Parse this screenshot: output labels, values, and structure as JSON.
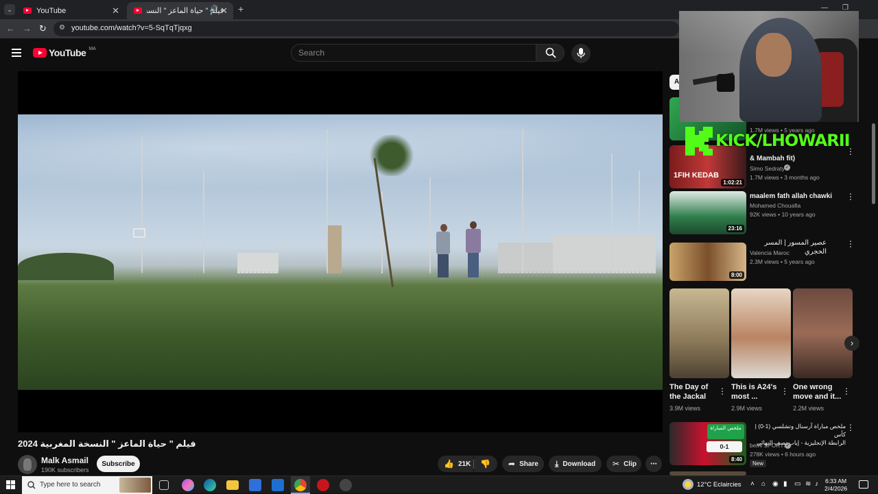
{
  "browser": {
    "tabs": [
      {
        "label": "YouTube"
      },
      {
        "label": "فيلم \" حياة الماعز \" النسخة الم..."
      }
    ],
    "url": "youtube.com/watch?v=5-SqTqTjqxg"
  },
  "youtube": {
    "logo_text": "YouTube",
    "region": "MA",
    "search_placeholder": "Search"
  },
  "video": {
    "title": "فيلم \" حياة الماعز \" النسخة المغربية 2024",
    "channel": "Malk Asmail",
    "subscribers": "190K subscribers",
    "subscribe_label": "Subscribe",
    "likes": "21K",
    "share_label": "Share",
    "download_label": "Download",
    "clip_label": "Clip"
  },
  "overlay": {
    "kick_text": "KICK/LHOWARII"
  },
  "sidebar": {
    "chip_letter": "A",
    "videos": [
      {
        "title": "",
        "meta1": "1.7M views • 5 years ago",
        "meta2": ""
      },
      {
        "title": "& Mambah fit)",
        "channel": "Simo Sedraty",
        "stats": "1.7M views • 3 months ago",
        "duration": "1:02:21"
      },
      {
        "title": "maalem fath allah chawki",
        "channel": "Mohamed Chouafia",
        "stats": "92K views • 10 years ago",
        "duration": "23:16"
      },
      {
        "title": "عصير المسور | المسر الحجري",
        "channel": "Valencia Maroc",
        "stats": "2.3M views • 5 years ago",
        "duration": "8:00"
      }
    ],
    "shorts": [
      {
        "title_line1": "The Day of",
        "title_line2": "the Jackal",
        "views": "3.9M views"
      },
      {
        "title_line1": "This is A24's",
        "title_line2": "most ...",
        "views": "2.9M views"
      },
      {
        "title_line1": "One wrong",
        "title_line2": "move and it...",
        "views": "2.2M views"
      }
    ],
    "last_video": {
      "title_line1": "ملخص مباراة آرسنال وتشلسي (1-0) | كأس",
      "title_line2": "الرابطة الإنجليزية - إياب نصف النهائي",
      "channel": "beIN SPORTS",
      "stats": "278K views • 6 hours ago",
      "badge": "New",
      "duration": "8:40",
      "thumb_label": "ملخص المباراة",
      "score": "0-1"
    }
  },
  "taskbar": {
    "search_placeholder": "Type here to search",
    "weather": "12°C  Eclaircies",
    "time": "6:33 AM",
    "date": "2/4/2026"
  }
}
